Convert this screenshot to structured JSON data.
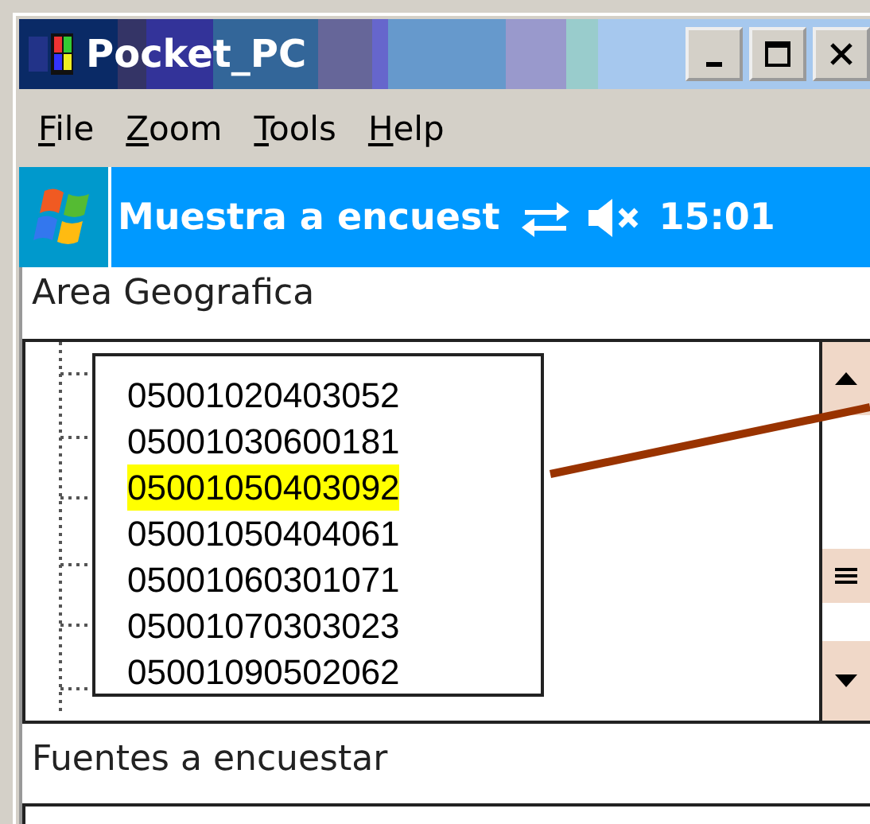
{
  "window": {
    "title": "Pocket_PC"
  },
  "menu": [
    {
      "label": "File"
    },
    {
      "label": "Zoom"
    },
    {
      "label": "Tools"
    },
    {
      "label": "Help"
    }
  ],
  "nav_bar": {
    "title": "Muestra a encuest",
    "time": "15:01"
  },
  "sections": [
    {
      "label": "Area Geografica"
    },
    {
      "label": "Fuentes a encuestar"
    }
  ],
  "callout": {
    "items": [
      {
        "text": "05001020403052",
        "selected": false
      },
      {
        "text": "05001030600181",
        "selected": false
      },
      {
        "text": "05001050403092",
        "selected": true
      },
      {
        "text": "05001050404061",
        "selected": false
      },
      {
        "text": "05001060301071",
        "selected": false
      },
      {
        "text": "05001070303023",
        "selected": false
      },
      {
        "text": "05001090502062",
        "selected": false
      }
    ]
  }
}
